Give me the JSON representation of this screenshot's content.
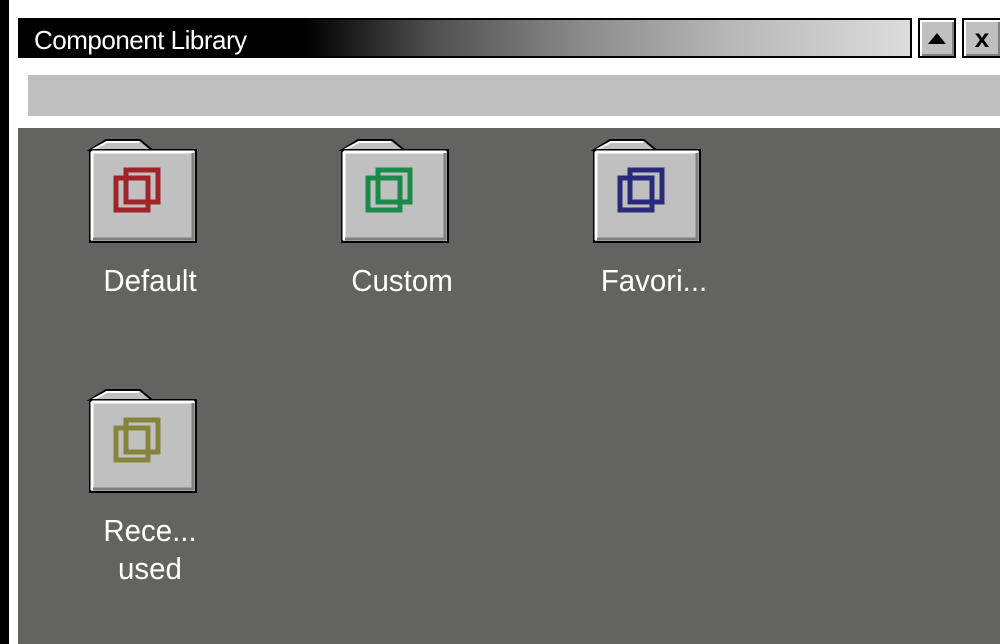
{
  "window": {
    "title": "Component Library",
    "buttons": {
      "minimize_icon": "triangle-up-icon",
      "close_label": "x"
    }
  },
  "items": [
    {
      "label": "Default",
      "label2": "",
      "icon": "folder-icon",
      "color": "#a02428"
    },
    {
      "label": "Custom",
      "label2": "",
      "icon": "folder-icon",
      "color": "#1a8a4a"
    },
    {
      "label": "Favori...",
      "label2": "",
      "icon": "folder-icon",
      "color": "#2a2a7a"
    },
    {
      "label": "Rece...",
      "label2": "used",
      "icon": "folder-icon",
      "color": "#86843a"
    }
  ]
}
